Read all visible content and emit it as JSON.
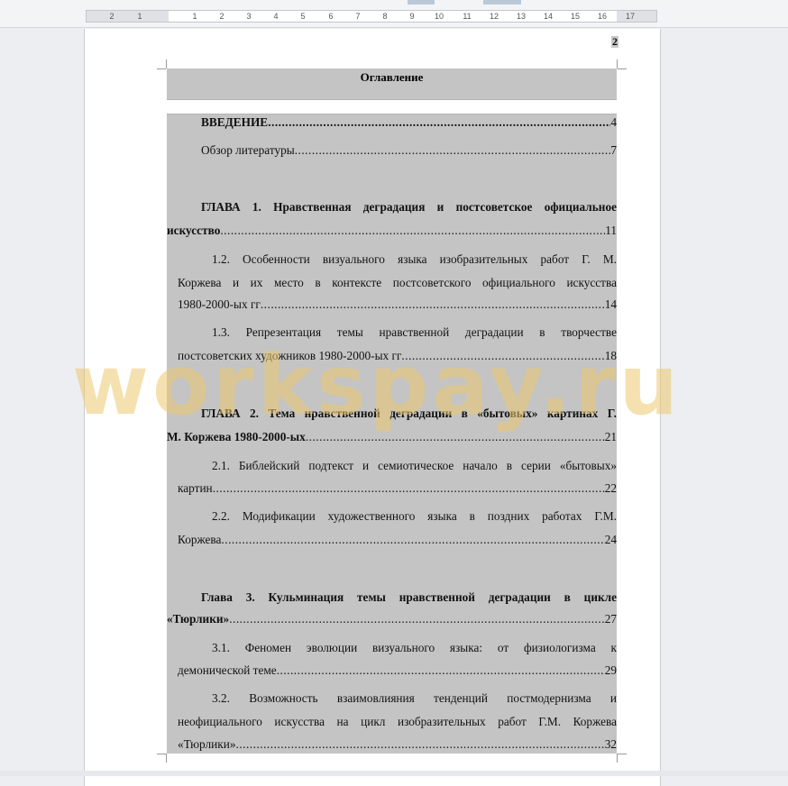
{
  "ruler": {
    "ticks": [
      "2",
      "1",
      "1",
      "2",
      "3",
      "4",
      "5",
      "6",
      "7",
      "8",
      "9",
      "10",
      "11",
      "12",
      "13",
      "14",
      "15",
      "16",
      "17"
    ]
  },
  "page": {
    "number": "2"
  },
  "toc": {
    "title": "Оглавление",
    "intro": {
      "text": "ВВЕДЕНИЕ",
      "page": "4"
    },
    "lit": {
      "text": "Обзор литературы",
      "page": "7"
    },
    "ch1": {
      "line1": "ГЛАВА 1. Нравственная деградация и постсоветское официальное",
      "line2": "искусство",
      "page": "11"
    },
    "s12": {
      "line1": "1.2. Особенности визуального языка изобразительных работ Г. М.",
      "line2": "Коржева и их место в контексте постсоветского официального искусства",
      "line3": "1980-2000-ых гг",
      "page": "14"
    },
    "s13": {
      "line1": "1.3. Репрезентация темы нравственной деградации в творчестве",
      "line2": "постсоветских художников 1980-2000-ых гг",
      "page": "18"
    },
    "ch2": {
      "line1": "ГЛАВА 2. Тема нравственной деградации в «бытовых» картинах Г.",
      "line2": "М. Коржева 1980-2000-ых",
      "page": "21"
    },
    "s21": {
      "line1": "2.1. Библейский подтекст и семиотическое начало в серии «бытовых»",
      "line2": "картин",
      "page": "22"
    },
    "s22": {
      "line1": "2.2. Модификации художественного языка в поздних работах Г.М.",
      "line2": "Коржева",
      "page": "24"
    },
    "ch3": {
      "line1": "Глава 3. Кульминация темы нравственной деградации в цикле",
      "line2": "«Тюрлики»",
      "page": "27"
    },
    "s31": {
      "line1": "3.1. Феномен эволюции визуального языка: от физиологизма к",
      "line2": "демонической теме",
      "page": "29"
    },
    "s32": {
      "line1": "3.2. Возможность взаимовлияния тенденций постмодернизма и",
      "line2": "неофициального искусства на цикл изобразительных работ Г.М. Коржева",
      "line3": "«Тюрлики»",
      "page": "32"
    }
  },
  "watermark": "workspay.ru"
}
